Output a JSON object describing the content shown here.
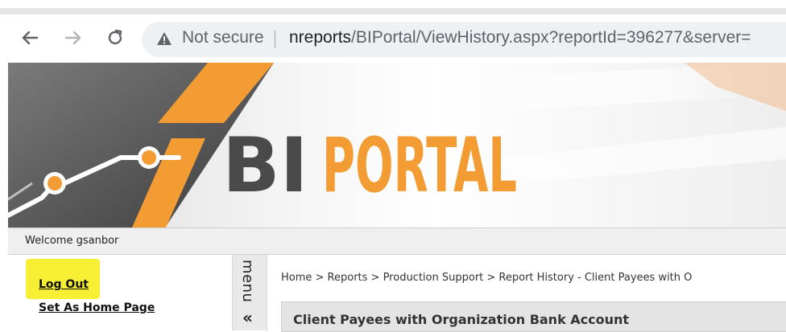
{
  "browser": {
    "security_label": "Not secure",
    "url_host": "nreports",
    "url_path": "/BIPortal/ViewHistory.aspx?reportId=396277&server="
  },
  "icons": {
    "back": "back-arrow-icon",
    "forward": "forward-arrow-icon",
    "reload": "reload-icon",
    "warning": "warning-icon",
    "collapse": "double-chevron-icon"
  },
  "banner": {
    "logo_bi": "BI",
    "logo_portal": "PORTAL",
    "colors": {
      "accent": "#f39c34",
      "dark": "#4a4a4a"
    }
  },
  "welcome_text": "Welcome gsanbor",
  "sidebar": {
    "logout_label": "Log Out",
    "homepage_label": "Set As Home Page"
  },
  "menu_label": "menu",
  "menu_toggle": "«",
  "breadcrumb": "Home > Reports > Production Support > Report History - Client Payees with O",
  "report_title": "Client Payees with Organization Bank Account"
}
